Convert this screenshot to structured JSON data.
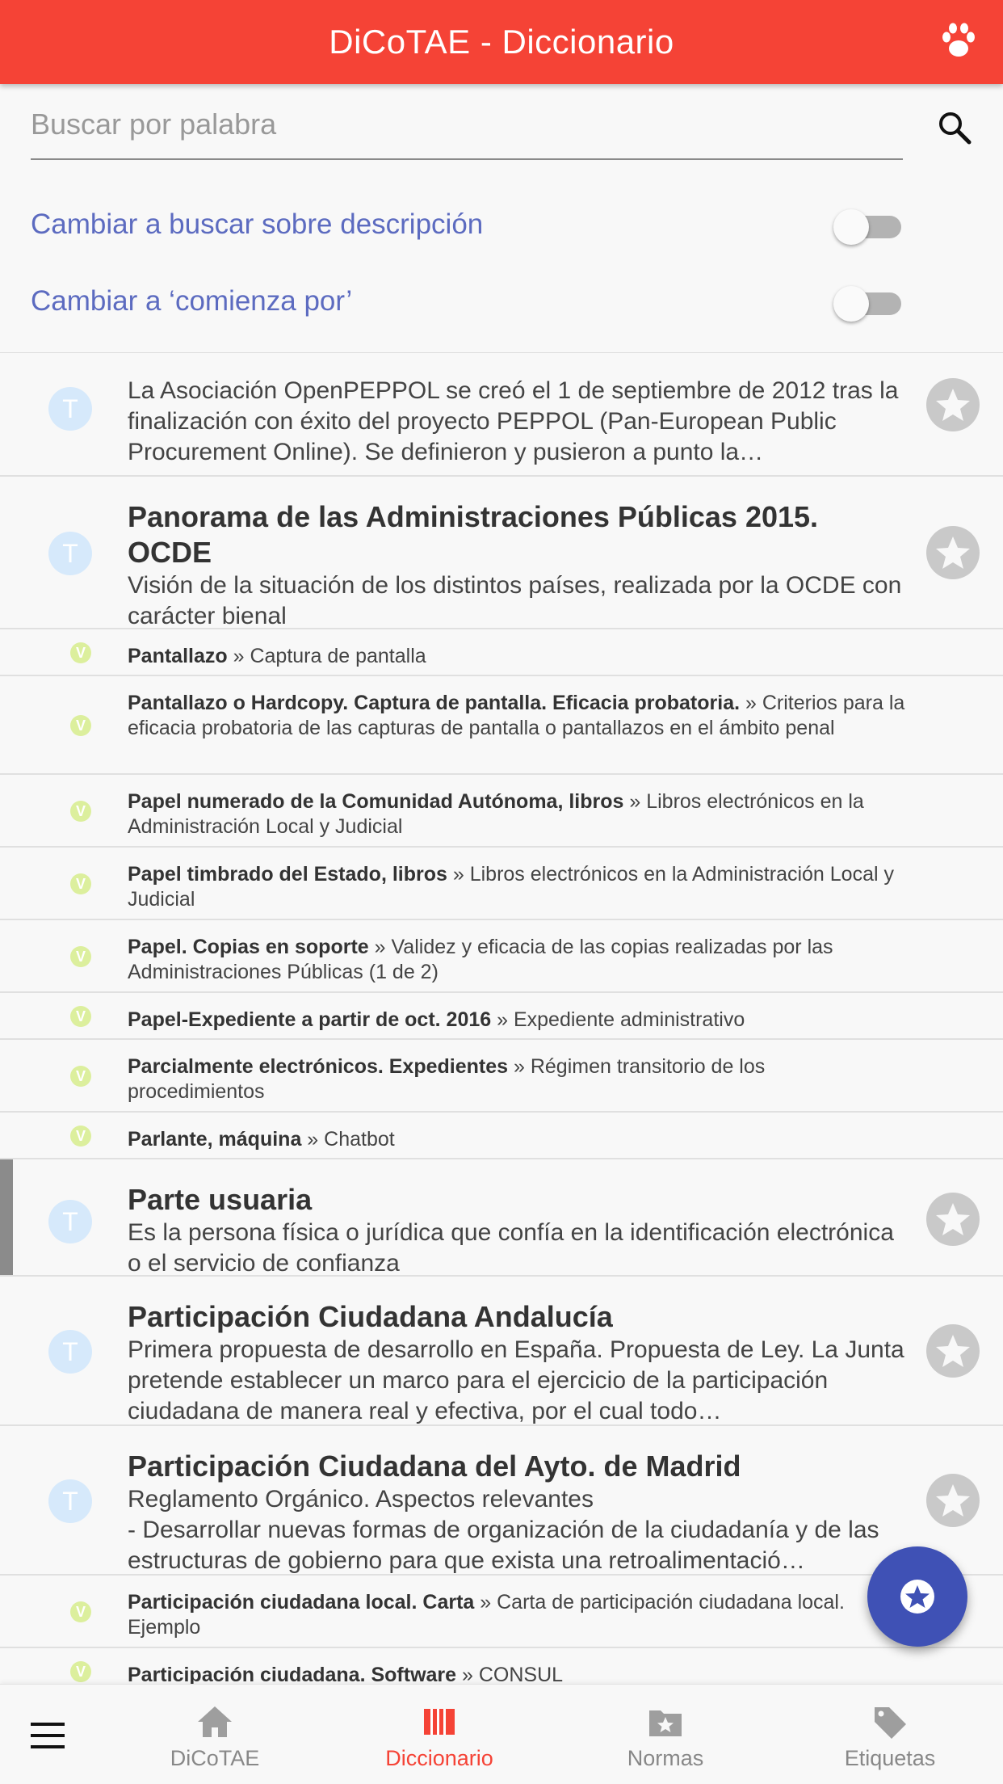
{
  "app": {
    "title": "DiCoTAE - Diccionario",
    "accent_color": "#f54336",
    "header_icon": "paw-icon"
  },
  "search": {
    "placeholder": "Buscar por palabra",
    "icon": "search-icon"
  },
  "toggles": [
    {
      "label": "Cambiar a buscar sobre descripción",
      "on": false
    },
    {
      "label": "Cambiar a ‘comienza por’",
      "on": false
    }
  ],
  "entries": [
    {
      "kind": "term",
      "badge": "T",
      "title": "",
      "description": "La Asociación OpenPEPPOL se creó el 1 de septiembre de 2012 tras la finalización con éxito del proyecto PEPPOL (Pan-European Public Procurement Online). Se definieron y pusieron a punto la…"
    },
    {
      "kind": "term",
      "badge": "T",
      "title": "Panorama de las Administraciones Públicas 2015. OCDE",
      "description": "Visión de la situación de los distintos países, realizada por la OCDE con carácter bienal"
    },
    {
      "kind": "see",
      "badge": "V",
      "title": "Pantallazo",
      "separator": " » ",
      "target": "Captura de pantalla"
    },
    {
      "kind": "see",
      "badge": "V",
      "title": "Pantallazo o Hardcopy. Captura de pantalla. Eficacia probatoria.",
      "separator": " » ",
      "target": "Criterios para la eficacia probatoria de las capturas de pantalla o pantallazos en el ámbito penal"
    },
    {
      "kind": "see",
      "badge": "V",
      "title": "Papel numerado de la Comunidad Autónoma, libros",
      "separator": " » ",
      "target": "Libros electrónicos en la Administración Local y Judicial"
    },
    {
      "kind": "see",
      "badge": "V",
      "title": "Papel timbrado del Estado, libros",
      "separator": " » ",
      "target": "Libros electrónicos en la Administración Local y Judicial"
    },
    {
      "kind": "see",
      "badge": "V",
      "title": "Papel. Copias en soporte",
      "separator": " » ",
      "target": "Validez y eficacia de las copias realizadas por las Administraciones Públicas (1 de 2)"
    },
    {
      "kind": "see",
      "badge": "V",
      "title": "Papel-Expediente a partir de oct. 2016",
      "separator": " » ",
      "target": "Expediente administrativo"
    },
    {
      "kind": "see",
      "badge": "V",
      "title": "Parcialmente electrónicos. Expedientes",
      "separator": " » ",
      "target": "Régimen transitorio de los procedimientos"
    },
    {
      "kind": "see",
      "badge": "V",
      "title": "Parlante, máquina",
      "separator": " » ",
      "target": "Chatbot"
    },
    {
      "kind": "term",
      "badge": "T",
      "title": "Parte usuaria",
      "description": "Es la persona física o jurídica que confía en la identificación electrónica o el servicio de confianza"
    },
    {
      "kind": "term",
      "badge": "T",
      "title": "Participación Ciudadana Andalucía",
      "description": "Primera propuesta de desarrollo en España. Propuesta de Ley. La Junta pretende establecer un marco para el ejercicio de la participación ciudadana de manera real y efectiva, por el cual todo…"
    },
    {
      "kind": "term",
      "badge": "T",
      "title": "Participación Ciudadana del Ayto. de Madrid",
      "description": "Reglamento Orgánico. Aspectos relevantes\n- Desarrollar nuevas formas de organización de la ciudadanía y de las estructuras de gobierno para que exista una retroalimentació…"
    },
    {
      "kind": "see",
      "badge": "V",
      "title": "Participación ciudadana local. Carta",
      "separator": " » ",
      "target": "Carta de participación ciudadana local. Ejemplo"
    },
    {
      "kind": "see",
      "badge": "V",
      "title": "Participación ciudadana. Software",
      "separator": " » ",
      "target": "CONSUL"
    }
  ],
  "fab": {
    "icon": "star-circle-icon",
    "color": "#3f51b5"
  },
  "bottom_nav": {
    "menu_icon": "hamburger-menu-icon",
    "tabs": [
      {
        "label": "DiCoTAE",
        "icon": "home-icon",
        "active": false
      },
      {
        "label": "Diccionario",
        "icon": "book-icon",
        "active": true
      },
      {
        "label": "Normas",
        "icon": "folder-star-icon",
        "active": false
      },
      {
        "label": "Etiquetas",
        "icon": "tag-icon",
        "active": false
      }
    ]
  }
}
